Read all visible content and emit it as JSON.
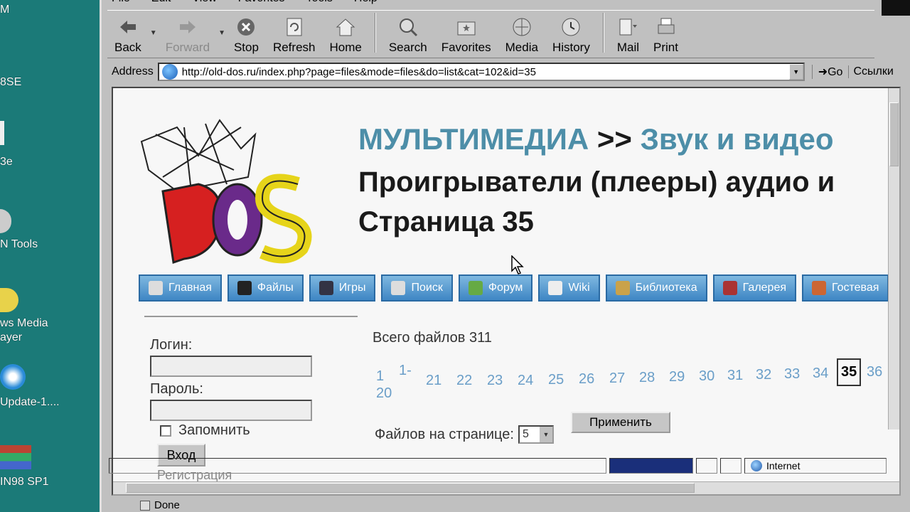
{
  "desktop": {
    "icons": [
      {
        "label": "M"
      },
      {
        "label": "8SE"
      },
      {
        "label": "3e"
      },
      {
        "label": "N Tools"
      },
      {
        "label_line1": "ws Media",
        "label_line2": "ayer"
      },
      {
        "label": "Update-1...."
      },
      {
        "label": "IN98 SP1"
      }
    ]
  },
  "browser": {
    "menu": [
      "File",
      "Edit",
      "View",
      "Favorites",
      "Tools",
      "Help"
    ],
    "toolbar": {
      "back": "Back",
      "forward": "Forward",
      "stop": "Stop",
      "refresh": "Refresh",
      "home": "Home",
      "search": "Search",
      "favorites": "Favorites",
      "media": "Media",
      "history": "History",
      "mail": "Mail",
      "print": "Print"
    },
    "address_label": "Address",
    "url": "http://old-dos.ru/index.php?page=files&mode=files&do=list&cat=102&id=35",
    "go_label": "Go",
    "links_label": "Ссылки",
    "status_zone": "Internet",
    "status_text": "Done"
  },
  "page": {
    "logo_text": "DOS",
    "title": {
      "section": "МУЛЬТИМЕДИА",
      "sep": ">>",
      "subsection": "Звук и видео",
      "heading": "Проигрыватели (плееры) аудио и",
      "page_label": "Страница 35"
    },
    "nav": [
      {
        "label": "Главная",
        "icon": "home-icon"
      },
      {
        "label": "Файлы",
        "icon": "terminal-icon"
      },
      {
        "label": "Игры",
        "icon": "invader-icon"
      },
      {
        "label": "Поиск",
        "icon": "magnifier-icon"
      },
      {
        "label": "Форум",
        "icon": "user-icon"
      },
      {
        "label": "Wiki",
        "icon": "wiki-icon"
      },
      {
        "label": "Библиотека",
        "icon": "book-icon"
      },
      {
        "label": "Галерея",
        "icon": "picture-icon"
      },
      {
        "label": "Гостевая",
        "icon": "guestbook-icon"
      }
    ],
    "login": {
      "login_label": "Логин:",
      "password_label": "Пароль:",
      "remember_label": "Запомнить",
      "enter_button": "Вход",
      "register_link": "Регистрация"
    },
    "total_files": "Всего файлов 311",
    "pager": {
      "first": "1",
      "range_top": "1-",
      "range_bottom": "20",
      "pages": [
        "21",
        "22",
        "23",
        "24",
        "25",
        "26",
        "27",
        "28",
        "29",
        "30",
        "31",
        "32",
        "33",
        "34"
      ],
      "current": "35",
      "next": "36"
    },
    "per_page_label": "Файлов на странице:",
    "per_page_value": "5",
    "apply_button": "Применить"
  }
}
